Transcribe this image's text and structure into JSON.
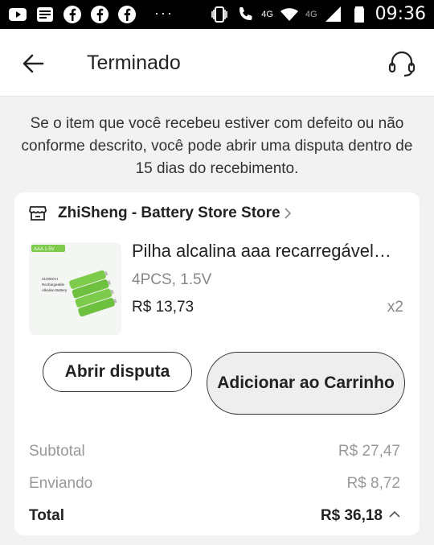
{
  "status_bar": {
    "time": "09:36",
    "network_label": "4G",
    "network_label_2": "4G",
    "left_icons": [
      "youtube-icon",
      "news-icon",
      "facebook-icon",
      "facebook-icon",
      "facebook-icon"
    ],
    "more_dots": "···"
  },
  "app_bar": {
    "title": "Terminado"
  },
  "notice": "Se o item que você recebeu estiver com defeito ou não conforme descrito, você pode abrir uma disputa dentro de 15 dias do recebimento.",
  "order": {
    "store_name": "ZhiSheng - Battery Store Store",
    "product": {
      "name": "Pilha alcalina aaa recarregável…",
      "variant": "4PCS, 1.5V",
      "price": "R$ 13,73",
      "quantity": "x2",
      "thumb_tag": "AAA 1.5V",
      "thumb_text_1": "2100MAH",
      "thumb_text_2": "Rechargeable",
      "thumb_text_3": "Alkaline Battery"
    },
    "buttons": {
      "dispute": "Abrir disputa",
      "add_to_cart": "Adicionar ao Carrinho"
    },
    "summary": {
      "subtotal_label": "Subtotal",
      "subtotal_value": "R$ 27,47",
      "shipping_label": "Enviando",
      "shipping_value": "R$ 8,72",
      "total_label": "Total",
      "total_value": "R$ 36,18"
    }
  },
  "colors": {
    "status_bar": "#000000",
    "background": "#f2f2f2",
    "card": "#ffffff",
    "battery_green": "#7ccb4a"
  }
}
